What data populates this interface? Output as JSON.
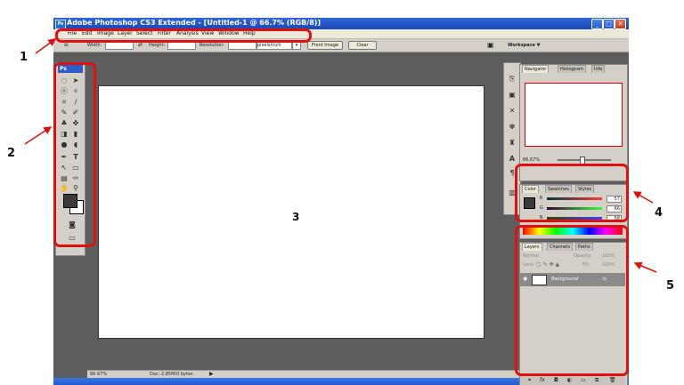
{
  "window": {
    "app_badge": "Ps",
    "title": "Adobe Photoshop CS3 Extended - [Untitled-1 @ 66.7% (RGB/8)]",
    "controls": {
      "minimize": "_",
      "maximize": "□",
      "close": "✕"
    }
  },
  "menu": [
    "File",
    "Edit",
    "Image",
    "Layer",
    "Select",
    "Filter",
    "Analysis",
    "View",
    "Window",
    "Help"
  ],
  "options": {
    "width_label": "Width:",
    "height_label": "Height:",
    "resolution_label": "Resolution:",
    "units": "pixels/inch",
    "front_image": "Front Image",
    "clear": "Clear",
    "workspace": "Workspace ▼"
  },
  "tools": {
    "badge": "Ps"
  },
  "panels": {
    "navigator": {
      "tabs": [
        "Navigator",
        "Histogram",
        "Info"
      ],
      "zoom": "66.67%"
    },
    "color": {
      "tabs": [
        "Color",
        "Swatches",
        "Styles"
      ],
      "channels": [
        {
          "label": "R",
          "value": "57"
        },
        {
          "label": "G",
          "value": "66"
        },
        {
          "label": "B",
          "value": "58"
        }
      ]
    },
    "layers": {
      "tabs": [
        "Layers",
        "Channels",
        "Paths"
      ],
      "blend": "Normal",
      "opacity_label": "Opacity:",
      "opacity": "100%",
      "lock_label": "Lock:",
      "fill_label": "Fill:",
      "fill": "100%",
      "layer_name": "Background"
    }
  },
  "status": {
    "zoom": "66.67%",
    "doc": "Doc: 2.85M/0 bytes"
  },
  "annotations": {
    "n1": "1",
    "n2": "2",
    "n3": "3",
    "n4": "4",
    "n5": "5"
  },
  "colors": {
    "annotation": "#e01010",
    "titlebar": "#1b48b4",
    "workspace_bg": "#5d5d5d",
    "color_swatch": "#3a3a3a"
  }
}
